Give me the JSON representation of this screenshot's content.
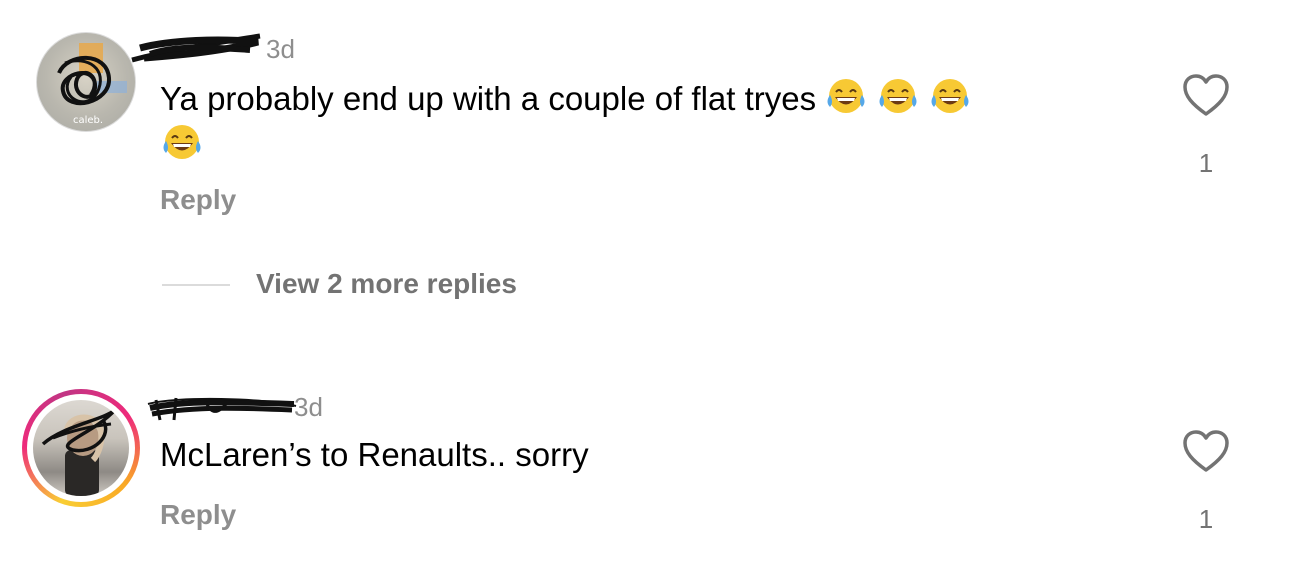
{
  "comments": [
    {
      "time_ago": "3d",
      "text": "Ya probably end up with a couple of flat tryes",
      "emojis": [
        "face-with-tears-of-joy",
        "face-with-tears-of-joy",
        "face-with-tears-of-joy",
        "face-with-tears-of-joy"
      ],
      "reply_label": "Reply",
      "like_count": "1",
      "view_replies_label": "View 2 more replies",
      "avatar_has_story": false
    },
    {
      "time_ago": "3d",
      "text": "McLaren’s to Renaults.. sorry",
      "reply_label": "Reply",
      "like_count": "1",
      "avatar_has_story": true
    }
  ],
  "colors": {
    "secondary_text": "#8e8e8e",
    "story_ring_start": "#f9ce34",
    "story_ring_mid": "#ee2a7b",
    "story_ring_end": "#c13584"
  },
  "icons": {
    "like": "heart-outline-icon",
    "emoji": "face-with-tears-of-joy"
  }
}
